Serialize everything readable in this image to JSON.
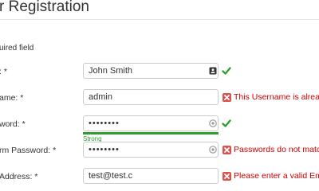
{
  "page": {
    "title": "r Registration",
    "required_note": "uired field"
  },
  "form": {
    "name": {
      "label": ": *",
      "value": "John Smith"
    },
    "username": {
      "label": "ame: *",
      "value": "admin",
      "error": "This Username is alread"
    },
    "password": {
      "label": "word: *",
      "value": "••••••••",
      "strength_label": "Strong",
      "strength": 1.0
    },
    "confirm": {
      "label": "rm Password: *",
      "value": "••••••••",
      "error": "Passwords do not matc"
    },
    "email": {
      "label": "Address: *",
      "value": "test@test.c",
      "error": "Please enter a valid Ema"
    }
  },
  "colors": {
    "valid": "#2f9e2f",
    "error": "#cc0000",
    "error_icon": "#d9534f",
    "border": "#cccccc"
  },
  "icons": {
    "name_field": "contact-card-icon",
    "password_field": "reveal-password-icon",
    "valid": "checkmark-icon",
    "invalid": "x-icon"
  }
}
